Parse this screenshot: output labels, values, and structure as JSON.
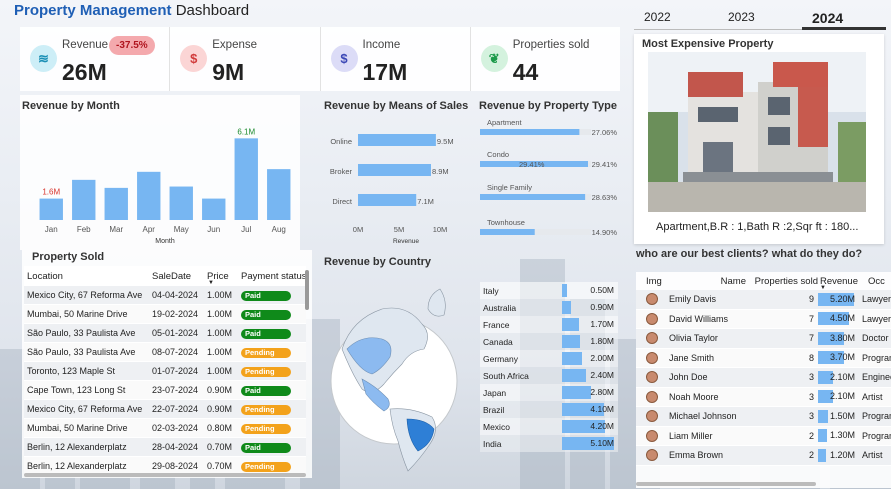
{
  "header": {
    "title_bold": "Property Management",
    "title_rest": " Dashboard"
  },
  "years": [
    {
      "label": "2022"
    },
    {
      "label": "2023"
    },
    {
      "label": "2024"
    }
  ],
  "kpis": [
    {
      "label": "Revenue",
      "value": "26M",
      "badge": "-37.5%",
      "icon": "revenue-icon"
    },
    {
      "label": "Expense",
      "value": "9M",
      "icon": "expense-icon"
    },
    {
      "label": "Income",
      "value": "17M",
      "icon": "income-icon"
    },
    {
      "label": "Properties sold",
      "value": "44",
      "icon": "properties-icon"
    }
  ],
  "most_expensive": {
    "title": "Most Expensive Property",
    "caption": "Apartment,B.R : 1,Bath R :2,Sqr ft : 180..."
  },
  "revenue_by_month": {
    "title": "Revenue by Month",
    "xlabel": "Month",
    "label_first": "1.6M",
    "label_max": "6.1M"
  },
  "means_of_sales": {
    "title": "Revenue by Means of Sales",
    "xlabel": "Revenue"
  },
  "property_type": {
    "title": "Revenue by Property Type"
  },
  "property_sold": {
    "title": "Property Sold",
    "headers": [
      "Location",
      "SaleDate",
      "Price",
      "Payment status"
    ],
    "rows": [
      {
        "location": "Mexico City, 67 Reforma Ave",
        "date": "04-04-2024",
        "price": "1.00M",
        "status": "Paid"
      },
      {
        "location": "Mumbai, 50 Marine Drive",
        "date": "19-02-2024",
        "price": "1.00M",
        "status": "Paid"
      },
      {
        "location": "São Paulo, 33 Paulista Ave",
        "date": "05-01-2024",
        "price": "1.00M",
        "status": "Paid"
      },
      {
        "location": "São Paulo, 33 Paulista Ave",
        "date": "08-07-2024",
        "price": "1.00M",
        "status": "Pending"
      },
      {
        "location": "Toronto, 123 Maple St",
        "date": "01-07-2024",
        "price": "1.00M",
        "status": "Pending"
      },
      {
        "location": "Cape Town, 123 Long St",
        "date": "23-07-2024",
        "price": "0.90M",
        "status": "Paid"
      },
      {
        "location": "Mexico City, 67 Reforma Ave",
        "date": "22-07-2024",
        "price": "0.90M",
        "status": "Pending"
      },
      {
        "location": "Mumbai, 50 Marine Drive",
        "date": "02-03-2024",
        "price": "0.80M",
        "status": "Pending"
      },
      {
        "location": "Berlin, 12 Alexanderplatz",
        "date": "28-04-2024",
        "price": "0.70M",
        "status": "Paid"
      },
      {
        "location": "Berlin, 12 Alexanderplatz",
        "date": "29-08-2024",
        "price": "0.70M",
        "status": "Pending"
      }
    ]
  },
  "country": {
    "title": "Revenue by Country",
    "rows": [
      {
        "name": "Italy",
        "label": "0.50M"
      },
      {
        "name": "Australia",
        "label": "0.90M"
      },
      {
        "name": "France",
        "label": "1.70M"
      },
      {
        "name": "Canada",
        "label": "1.80M"
      },
      {
        "name": "Germany",
        "label": "2.00M"
      },
      {
        "name": "South Africa",
        "label": "2.40M"
      },
      {
        "name": "Japan",
        "label": "2.80M"
      },
      {
        "name": "Brazil",
        "label": "4.10M"
      },
      {
        "name": "Mexico",
        "label": "4.20M"
      },
      {
        "name": "India",
        "label": "5.10M"
      }
    ]
  },
  "clients": {
    "title": "who are our best clients?  what do they do?",
    "headers": [
      "Img",
      "Name",
      "Properties sold",
      "Revenue",
      "Occ"
    ],
    "rows": [
      {
        "name": "Emily Davis",
        "sold": "9",
        "revenue": "5.20M",
        "occ": "Lawyer",
        "rev": 5.2
      },
      {
        "name": "David Williams",
        "sold": "7",
        "revenue": "4.50M",
        "occ": "Lawyer",
        "rev": 4.5
      },
      {
        "name": "Olivia Taylor",
        "sold": "7",
        "revenue": "3.80M",
        "occ": "Doctor",
        "rev": 3.8
      },
      {
        "name": "Jane Smith",
        "sold": "8",
        "revenue": "3.70M",
        "occ": "Programmer",
        "rev": 3.7
      },
      {
        "name": "John Doe",
        "sold": "3",
        "revenue": "2.10M",
        "occ": "Engineer",
        "rev": 2.1
      },
      {
        "name": "Noah Moore",
        "sold": "3",
        "revenue": "2.10M",
        "occ": "Artist",
        "rev": 2.1
      },
      {
        "name": "Michael Johnson",
        "sold": "3",
        "revenue": "1.50M",
        "occ": "Programmer",
        "rev": 1.5
      },
      {
        "name": "Liam Miller",
        "sold": "2",
        "revenue": "1.30M",
        "occ": "Programmer",
        "rev": 1.3
      },
      {
        "name": "Emma Brown",
        "sold": "2",
        "revenue": "1.20M",
        "occ": "Artist",
        "rev": 1.2
      }
    ]
  },
  "colors": {
    "accent": "#1f5fb5",
    "bar": "#77b6f2",
    "paid": "#0f8a1a",
    "pending": "#f3a21b",
    "badge_bg": "#f4a9ad"
  },
  "chart_data": [
    {
      "type": "bar",
      "title": "Revenue by Month",
      "xlabel": "Month",
      "categories": [
        "Jan",
        "Feb",
        "Mar",
        "Apr",
        "May",
        "Jun",
        "Jul",
        "Aug"
      ],
      "values": [
        1.6,
        3.0,
        2.4,
        3.6,
        2.5,
        1.6,
        6.1,
        3.8
      ],
      "ylim": [
        0,
        6.5
      ]
    },
    {
      "type": "bar",
      "orientation": "horizontal",
      "title": "Revenue by Means of Sales",
      "xlabel": "Revenue",
      "categories": [
        "Online",
        "Broker",
        "Direct"
      ],
      "values": [
        9.5,
        8.9,
        7.1
      ],
      "labels": [
        "9.5M",
        "8.9M",
        "7.1M"
      ],
      "ticks": [
        "0M",
        "5M",
        "10M"
      ],
      "xlim": [
        0,
        10
      ]
    },
    {
      "type": "bar",
      "orientation": "horizontal",
      "title": "Revenue by Property Type",
      "categories": [
        "Apartment",
        "Condo",
        "Single Family",
        "Townhouse"
      ],
      "values": [
        27.06,
        29.41,
        28.63,
        14.9
      ],
      "labels": [
        "27.06%",
        "29.41%",
        "28.63%",
        "14.90%"
      ],
      "annotation": "29.41%"
    },
    {
      "type": "bar",
      "orientation": "horizontal",
      "title": "Revenue by Country",
      "categories": [
        "Italy",
        "Australia",
        "France",
        "Canada",
        "Germany",
        "South Africa",
        "Japan",
        "Brazil",
        "Mexico",
        "India"
      ],
      "values": [
        0.5,
        0.9,
        1.7,
        1.8,
        2.0,
        2.4,
        2.8,
        4.1,
        4.2,
        5.1
      ]
    }
  ]
}
